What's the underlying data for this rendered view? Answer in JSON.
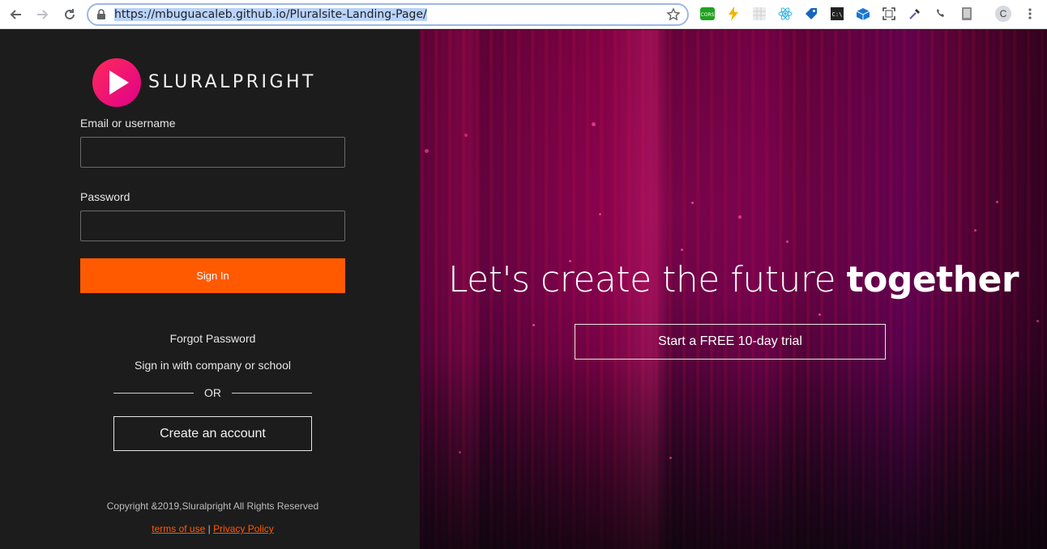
{
  "browser": {
    "url": "https://mbuguacaleb.github.io/Pluralsite-Landing-Page/",
    "profile_initial": "C",
    "extensions": [
      "cors-icon",
      "bolt-icon",
      "grid-icon",
      "react-icon",
      "tag-icon",
      "terminal-icon",
      "box-icon",
      "screenshot-icon",
      "eyedropper-icon",
      "phone-icon",
      "device-icon"
    ]
  },
  "brand": {
    "name": "SLURALPRIGHT",
    "logo_color": "#ff1f6e"
  },
  "login": {
    "email_label": "Email or username",
    "email_value": "",
    "password_label": "Password",
    "password_value": "",
    "signin_label": "Sign In",
    "forgot_label": "Forgot Password",
    "company_label": "Sign in with company or school",
    "or_label": "OR",
    "create_label": "Create an account"
  },
  "footer": {
    "copyright": "Copyright &2019,Sluralpright All Rights Reserved",
    "terms_label": "terms of use",
    "separator": "|",
    "privacy_label": "Privacy Policy"
  },
  "hero": {
    "headline_light": "Let's create the future ",
    "headline_bold": "together",
    "trial_label": "Start a FREE 10-day trial"
  },
  "colors": {
    "accent": "#ff5a00",
    "panel_bg": "#1c1c1c"
  }
}
